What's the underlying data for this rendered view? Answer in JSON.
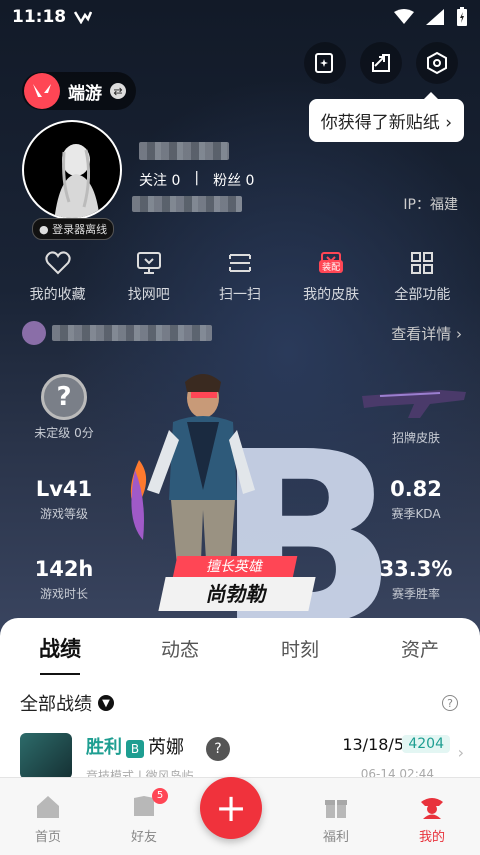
{
  "status_bar": {
    "time": "11:18"
  },
  "header": {
    "game_name": "端游",
    "tooltip": "你获得了新贴纸"
  },
  "profile": {
    "login_status": "登录器离线",
    "follow_label": "关注",
    "follow_count": "0",
    "fans_label": "粉丝",
    "fans_count": "0",
    "ip": "IP：福建"
  },
  "actions": [
    {
      "label": "我的收藏",
      "icon": "heart-icon"
    },
    {
      "label": "找网吧",
      "icon": "monitor-icon"
    },
    {
      "label": "扫一扫",
      "icon": "scan-icon",
      "badge": ""
    },
    {
      "label": "我的皮肤",
      "icon": "skin-icon",
      "badge": "装配"
    },
    {
      "label": "全部功能",
      "icon": "grid-icon"
    }
  ],
  "detail_link": "查看详情",
  "stats": {
    "rank": "未定级 0分",
    "signature_skin": "招牌皮肤",
    "level_value": "Lv41",
    "level_label": "游戏等级",
    "kda_value": "0.82",
    "kda_label": "赛季KDA",
    "time_value": "142h",
    "time_label": "游戏时长",
    "winrate_value": "33.3%",
    "winrate_label": "赛季胜率",
    "rank_letter": "B"
  },
  "hero": {
    "label": "擅长英雄",
    "name": "尚勃勒"
  },
  "tabs": [
    "战绩",
    "动态",
    "时刻",
    "资产"
  ],
  "records_header": "全部战绩",
  "record": {
    "result": "胜利",
    "grade": "B",
    "agent": "芮娜",
    "kda": "13/18/5",
    "score": "4204",
    "mode": "竞技模式 | 微风岛屿",
    "date": "06-14 02:44"
  },
  "bottom_nav": [
    {
      "label": "首页",
      "icon": "home-icon"
    },
    {
      "label": "好友",
      "icon": "friends-icon",
      "badge": "5"
    },
    {
      "label": "",
      "icon": "plus-icon"
    },
    {
      "label": "福利",
      "icon": "gift-icon"
    },
    {
      "label": "我的",
      "icon": "profile-icon"
    }
  ],
  "colors": {
    "accent": "#ff4655",
    "win": "#1e9e91"
  }
}
